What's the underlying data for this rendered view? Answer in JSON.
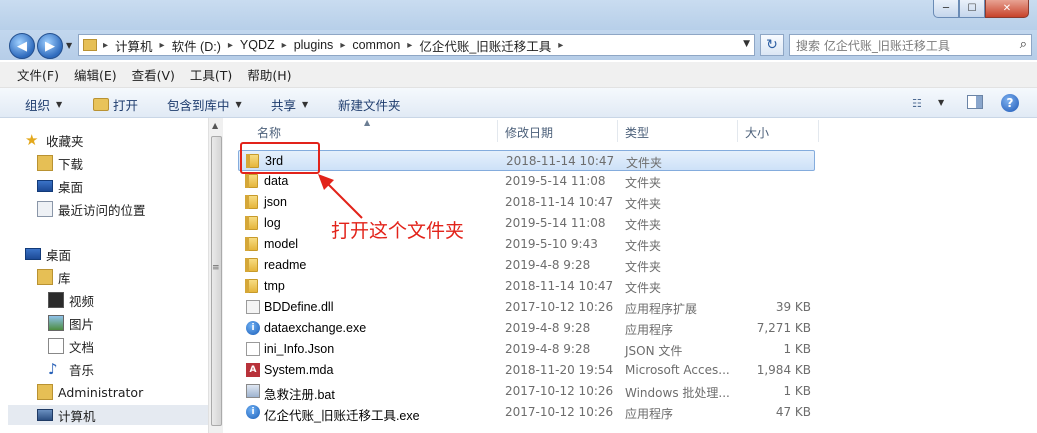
{
  "window": {
    "minimize": "─",
    "maximize": "☐",
    "close": "✕"
  },
  "nav": {
    "back_icon": "back-arrow-icon",
    "forward_icon": "forward-arrow-icon",
    "breadcrumbs": [
      "计算机",
      "软件 (D:)",
      "YQDZ",
      "plugins",
      "common",
      "亿企代账_旧账迁移工具"
    ],
    "search_placeholder": "搜索 亿企代账_旧账迁移工具"
  },
  "menu": [
    "文件(F)",
    "编辑(E)",
    "查看(V)",
    "工具(T)",
    "帮助(H)"
  ],
  "commands": {
    "organize": "组织",
    "open": "打开",
    "include_in_library": "包含到库中",
    "share": "共享",
    "new_folder": "新建文件夹"
  },
  "sidebar": {
    "favorites": "收藏夹",
    "downloads": "下载",
    "desktop_fav": "桌面",
    "recent_places": "最近访问的位置",
    "desktop": "桌面",
    "libraries": "库",
    "videos": "视频",
    "pictures": "图片",
    "documents": "文档",
    "music": "音乐",
    "administrator": "Administrator",
    "computer": "计算机"
  },
  "columns": {
    "name": "名称",
    "date": "修改日期",
    "type": "类型",
    "size": "大小"
  },
  "files": [
    {
      "name": "3rd",
      "date": "2018-11-14 10:47",
      "type": "文件夹",
      "size": "",
      "icon": "folder"
    },
    {
      "name": "data",
      "date": "2019-5-14 11:08",
      "type": "文件夹",
      "size": "",
      "icon": "folder"
    },
    {
      "name": "json",
      "date": "2018-11-14 10:47",
      "type": "文件夹",
      "size": "",
      "icon": "folder"
    },
    {
      "name": "log",
      "date": "2019-5-14 11:08",
      "type": "文件夹",
      "size": "",
      "icon": "folder"
    },
    {
      "name": "model",
      "date": "2019-5-10 9:43",
      "type": "文件夹",
      "size": "",
      "icon": "folder"
    },
    {
      "name": "readme",
      "date": "2019-4-8 9:28",
      "type": "文件夹",
      "size": "",
      "icon": "folder"
    },
    {
      "name": "tmp",
      "date": "2018-11-14 10:47",
      "type": "文件夹",
      "size": "",
      "icon": "folder"
    },
    {
      "name": "BDDefine.dll",
      "date": "2017-10-12 10:26",
      "type": "应用程序扩展",
      "size": "39 KB",
      "icon": "dll"
    },
    {
      "name": "dataexchange.exe",
      "date": "2019-4-8 9:28",
      "type": "应用程序",
      "size": "7,271 KB",
      "icon": "exe"
    },
    {
      "name": "ini_Info.Json",
      "date": "2019-4-8 9:28",
      "type": "JSON 文件",
      "size": "1 KB",
      "icon": "json"
    },
    {
      "name": "System.mda",
      "date": "2018-11-20 19:54",
      "type": "Microsoft Acces...",
      "size": "1,984 KB",
      "icon": "mda"
    },
    {
      "name": "急救注册.bat",
      "date": "2017-10-12 10:26",
      "type": "Windows 批处理...",
      "size": "1 KB",
      "icon": "bat"
    },
    {
      "name": "亿企代账_旧账迁移工具.exe",
      "date": "2017-10-12 10:26",
      "type": "应用程序",
      "size": "47 KB",
      "icon": "exe"
    }
  ],
  "annotation": {
    "text": "打开这个文件夹",
    "color": "#e2231a"
  }
}
